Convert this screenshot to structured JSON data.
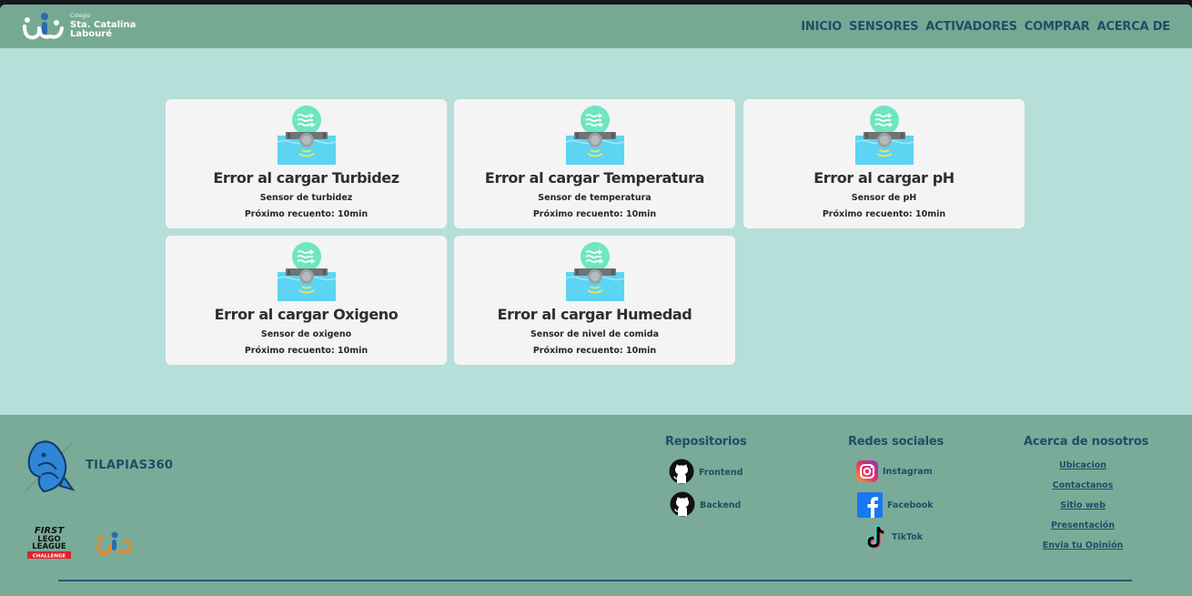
{
  "header": {
    "logo": {
      "small": "Colegio",
      "line1": "Sta. Catalina",
      "line2": "Labouré"
    },
    "nav": [
      "INICIO",
      "SENSORES",
      "ACTIVADORES",
      "COMPRAR",
      "ACERCA DE"
    ]
  },
  "cards": [
    {
      "title": "Error al cargar Turbidez",
      "subtitle": "Sensor de turbidez",
      "next": "Próximo recuento: 10min"
    },
    {
      "title": "Error al cargar Temperatura",
      "subtitle": "Sensor de temperatura",
      "next": "Próximo recuento: 10min"
    },
    {
      "title": "Error al cargar pH",
      "subtitle": "Sensor de pH",
      "next": "Próximo recuento: 10min"
    },
    {
      "title": "Error al cargar Oxigeno",
      "subtitle": "Sensor de oxigeno",
      "next": "Próximo recuento: 10min"
    },
    {
      "title": "Error al cargar Humedad",
      "subtitle": "Sensor de nivel de comida",
      "next": "Próximo recuento: 10min"
    }
  ],
  "footer": {
    "brand": "TILAPIAS360",
    "fll": {
      "line1": "FIRST",
      "line2": "LEGO",
      "line3": "LEAGUE",
      "line4": "CHALLENGE"
    },
    "repos": {
      "title": "Repositorios",
      "links": [
        "Frontend",
        "Backend"
      ]
    },
    "social": {
      "title": "Redes sociales",
      "links": [
        "Instagram",
        "Facebook",
        "TikTok"
      ]
    },
    "about": {
      "title": "Acerca de nosotros",
      "links": [
        "Ubicacion",
        "Contactanos",
        "Sitio web",
        "Presentación",
        "Envia tu Opinión"
      ]
    }
  },
  "colors": {
    "page_bg": "#b6dfd9",
    "header_bg": "#76a994",
    "footer_bg": "#7aab98",
    "nav_text": "#1f4e67",
    "card_bg": "#f4f4f4",
    "icon_water": "#5cd4f2",
    "icon_circle": "#6ee6c0"
  }
}
